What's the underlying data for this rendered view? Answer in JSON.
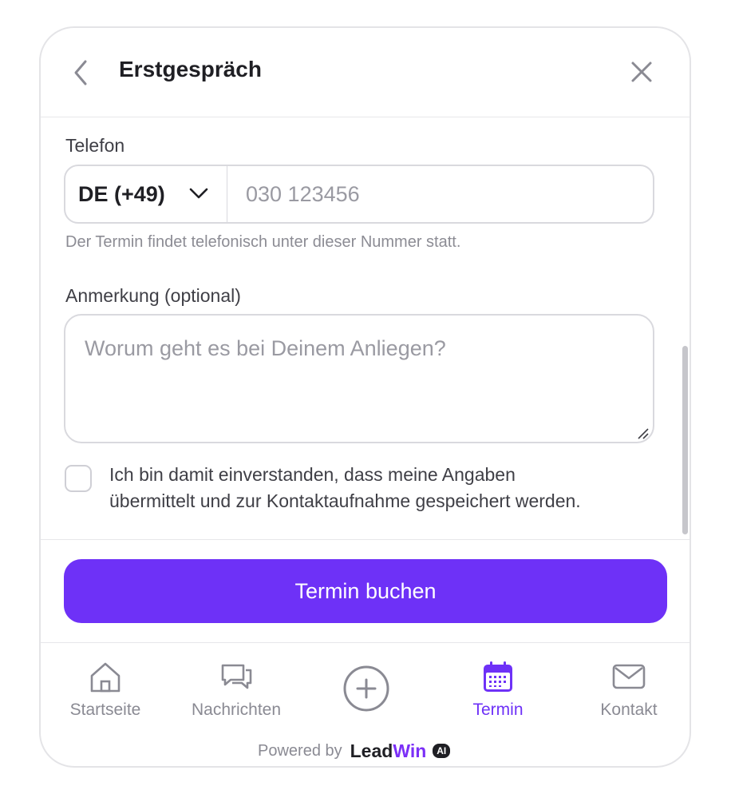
{
  "header": {
    "title": "Erstgespräch"
  },
  "phone": {
    "label": "Telefon",
    "country": "DE (+49)",
    "placeholder": "030 123456",
    "hint": "Der Termin findet telefonisch unter dieser Nummer statt."
  },
  "note": {
    "label": "Anmerkung (optional)",
    "placeholder": "Worum geht es bei Deinem Anliegen?"
  },
  "consent": {
    "checked": false,
    "line1": "Ich bin damit einverstanden, dass meine Angaben",
    "line2": "übermittelt und zur Kontaktaufnahme gespeichert werden."
  },
  "cta": {
    "label": "Termin buchen"
  },
  "nav": {
    "active": "Termin",
    "items": [
      {
        "label": "Startseite",
        "icon": "home-icon"
      },
      {
        "label": "Nachrichten",
        "icon": "chat-icon"
      },
      {
        "label": "Termin",
        "icon": "calendar-icon"
      },
      {
        "label": "Kontakt",
        "icon": "mail-icon"
      }
    ],
    "center_icon": "plus-circle-icon"
  },
  "footer": {
    "powered_by": "Powered by",
    "brand_part1": "Lead",
    "brand_part2": "Win",
    "badge": "AI"
  },
  "colors": {
    "accent": "#6e31f7",
    "brand_win": "#7b2ff7",
    "muted": "#8a8a93",
    "border": "#d9d9de"
  }
}
